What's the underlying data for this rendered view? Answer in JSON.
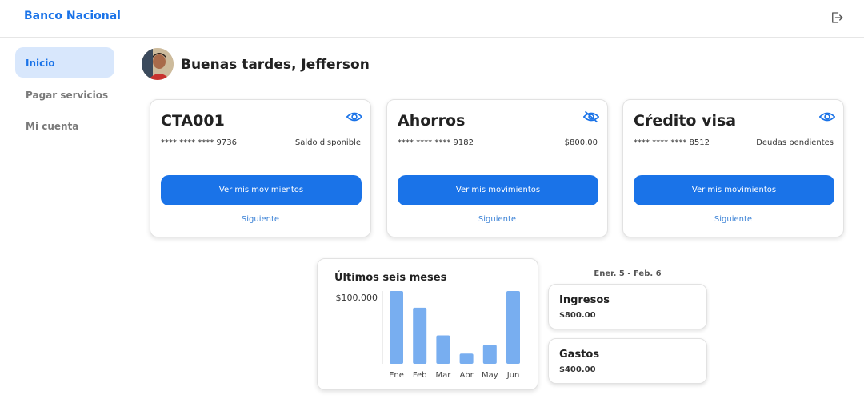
{
  "app": {
    "brand": "Banco Nacional",
    "logout_icon": "logout-icon"
  },
  "sidebar": {
    "items": [
      {
        "label": "Inicio",
        "active": true
      },
      {
        "label": "Pagar servicios",
        "active": false
      },
      {
        "label": "Mi cuenta",
        "active": false
      }
    ]
  },
  "greeting": "Buenas tardes, Jefferson",
  "accounts": [
    {
      "title": "CTA001",
      "number": "**** **** **** 9736",
      "right_text": "Saldo disponible",
      "eye_icon": "eye-icon",
      "button": "Ver mis movimientos",
      "link": "Siguiente"
    },
    {
      "title": "Ahorros",
      "number": "**** **** **** 9182",
      "right_text": "$800.00",
      "eye_icon": "eye-off-icon",
      "button": "Ver mis movimientos",
      "link": "Siguiente"
    },
    {
      "title": "Cŕedito visa",
      "number": "**** **** **** 8512",
      "right_text": "Deudas pendientes",
      "eye_icon": "eye-icon",
      "button": "Ver mis movimientos",
      "link": "Siguiente"
    }
  ],
  "summary": {
    "period": "Ener. 5 - Feb. 6",
    "income": {
      "label": "Ingresos",
      "value": "$800.00"
    },
    "expenses": {
      "label": "Gastos",
      "value": "$400.00"
    }
  },
  "chart_data": {
    "type": "bar",
    "title": "Últimos seis meses",
    "categories": [
      "Ene",
      "Feb",
      "Mar",
      "Abr",
      "May",
      "Jun"
    ],
    "values": [
      100000,
      77000,
      39000,
      14000,
      26000,
      100000
    ],
    "ytick_label": "$100.000",
    "ytick_value": 100000,
    "ylim": [
      0,
      100000
    ],
    "color": "#78aef0"
  },
  "colors": {
    "accent": "#1a73e8",
    "active_bg": "#d8e7fc",
    "bar": "#78aef0"
  }
}
